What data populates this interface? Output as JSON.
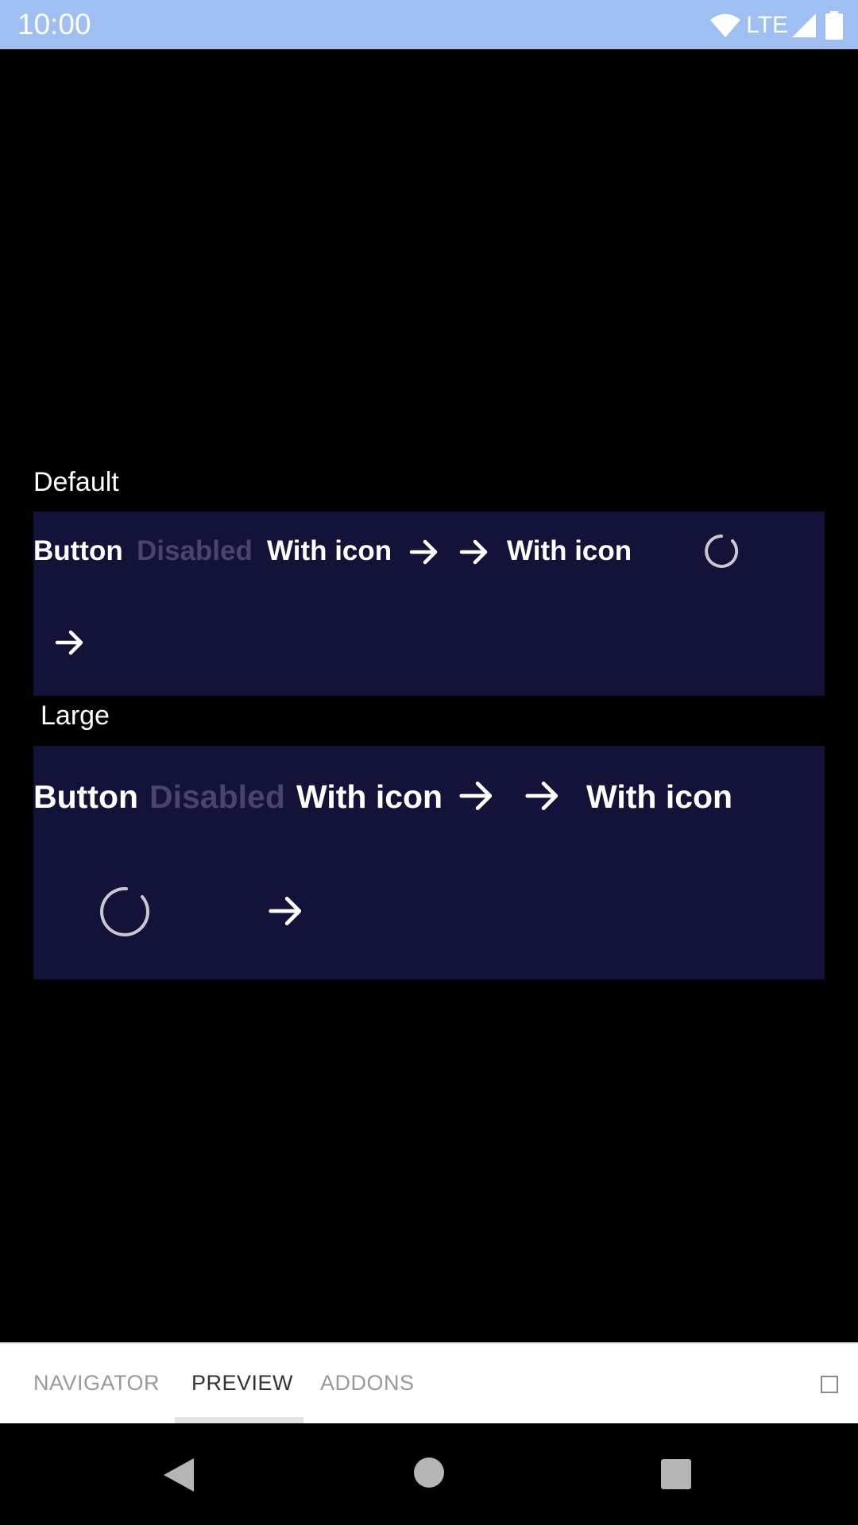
{
  "status_bar": {
    "time": "10:00",
    "network": "LTE",
    "icons": [
      "wifi-icon",
      "cell-signal-icon",
      "battery-icon"
    ]
  },
  "sections": [
    {
      "title": "Default",
      "buttons": [
        "Button",
        "Disabled",
        "With icon",
        "With icon"
      ]
    },
    {
      "title": "Large",
      "buttons": [
        "Button",
        "Disabled",
        "With icon",
        "With icon"
      ]
    }
  ],
  "tabs": [
    {
      "label": "NAVIGATOR",
      "active": false
    },
    {
      "label": "PREVIEW",
      "active": true
    },
    {
      "label": "ADDONS",
      "active": false
    }
  ],
  "nav_icons": [
    "back-icon",
    "home-icon",
    "recents-icon"
  ],
  "colors": {
    "status_bar": "#9fbff2",
    "panel": "#131238",
    "disabled_text": "#47456a",
    "background": "#000000"
  }
}
